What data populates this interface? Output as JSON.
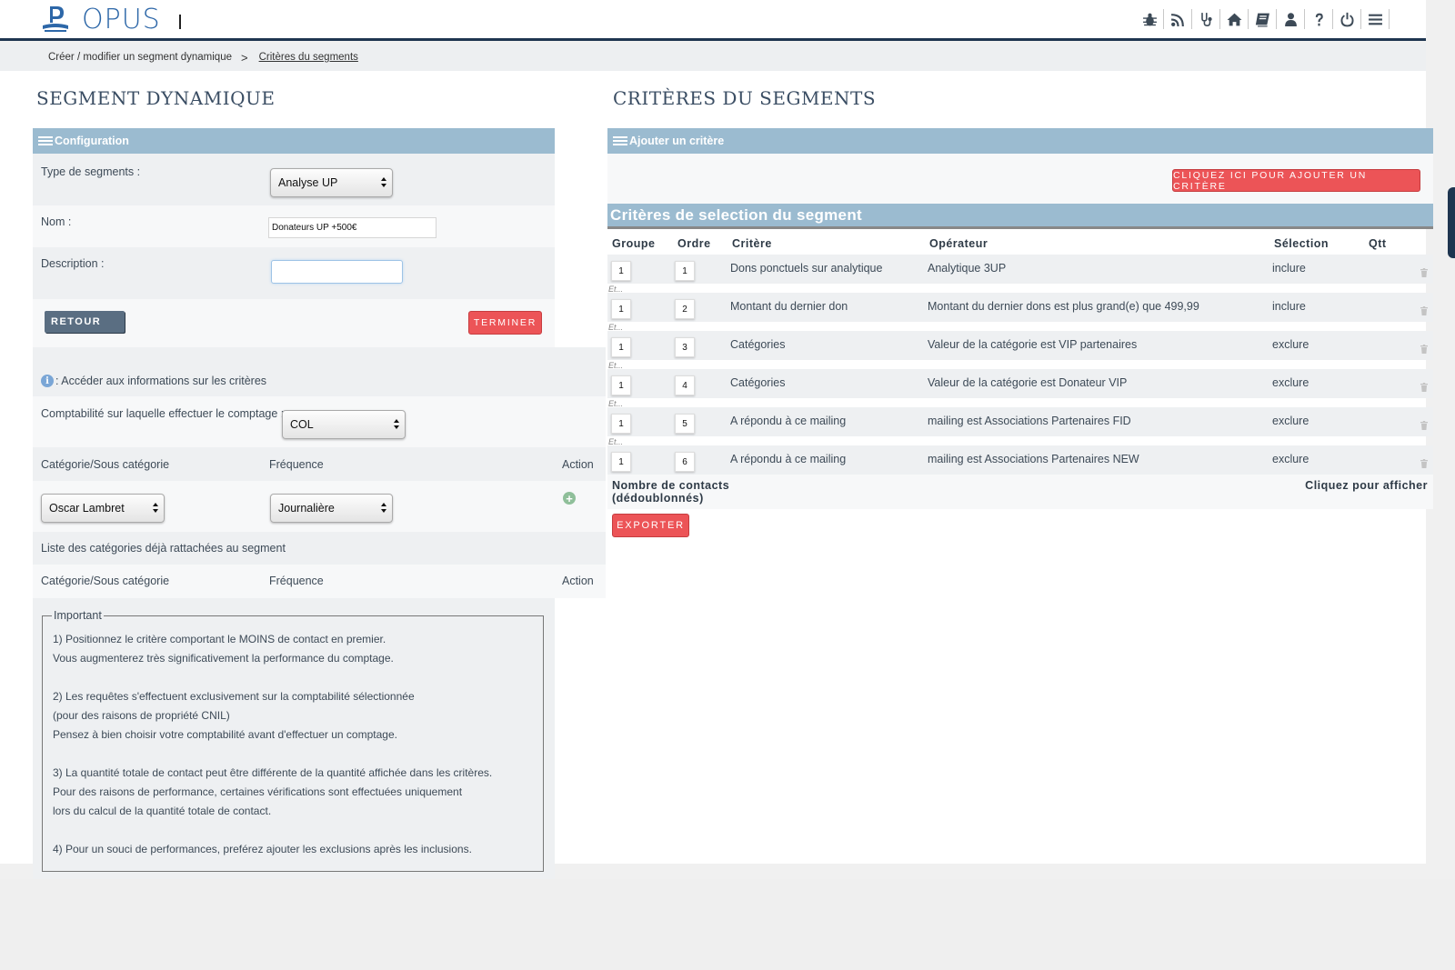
{
  "app": {
    "logo_text": "OPUS"
  },
  "header": {
    "icons": [
      "bug-icon",
      "rss-icon",
      "stethoscope-icon",
      "home-icon",
      "book-icon",
      "user-icon",
      "help-icon",
      "power-icon",
      "menu-icon"
    ]
  },
  "breadcrumb": {
    "items": [
      "Créer / modifier un segment dynamique",
      "Critères du segments"
    ],
    "separator": ">"
  },
  "left": {
    "title": "SEGMENT DYNAMIQUE",
    "config_label": "Configuration",
    "type_label": "Type de segments :",
    "type_value": "Analyse UP",
    "name_label": "Nom :",
    "name_value": "Donateurs UP +500€",
    "description_label": "Description :",
    "back_label": "RETOUR",
    "finish_label": "TERMINER",
    "info_text": ": Accéder aux informations sur les critères",
    "accounting_label": "Comptabilité sur laquelle effectuer le comptage :",
    "accounting_value": "COL",
    "cat_col_label": "Catégorie/Sous catégorie",
    "freq_col_label": "Fréquence",
    "action_col_label": "Action",
    "category_value": "Oscar Lambret",
    "frequency_value": "Journalière",
    "attached_label": "Liste des catégories déjà rattachées au segment",
    "important": {
      "legend": "Important",
      "lines": [
        "1) Positionnez le critère comportant le MOINS de contact en premier.",
        "Vous augmenterez très significativement la performance du comptage.",
        "",
        "2) Les requêtes s'effectuent exclusivement sur la comptabilité sélectionnée",
        "(pour des raisons de propriété CNIL)",
        "Pensez à bien choisir votre comptabilité avant d'effectuer un comptage.",
        "",
        "3) La quantité totale de contact peut être différente de la quantité affichée dans les critères.",
        "Pour des raisons de performance, certaines vérifications sont effectuées uniquement",
        "lors du calcul de la quantité totale de contact.",
        "",
        "4) Pour un souci de performances, preférez ajouter les exclusions après les inclusions."
      ]
    }
  },
  "right": {
    "title": "CRITÈRES DU SEGMENTS",
    "add_label": "Ajouter un critère",
    "add_button": "CLIQUEZ ICI POUR AJOUTER UN CRITÈRE",
    "selection_title": "Critères de selection du segment",
    "columns": [
      "Groupe",
      "Ordre",
      "Critère",
      "Opérateur",
      "Sélection",
      "Qtt"
    ],
    "and_label": "Et...",
    "rows": [
      {
        "group": "1",
        "order": "1",
        "criterion": "Dons ponctuels sur analytique",
        "operator": "Analytique 3UP",
        "selection": "inclure"
      },
      {
        "group": "1",
        "order": "2",
        "criterion": "Montant du dernier don",
        "operator": "Montant du dernier dons est plus grand(e) que 499,99",
        "selection": "inclure"
      },
      {
        "group": "1",
        "order": "3",
        "criterion": "Catégories",
        "operator": "Valeur de la catégorie est VIP partenaires",
        "selection": "exclure"
      },
      {
        "group": "1",
        "order": "4",
        "criterion": "Catégories",
        "operator": "Valeur de la catégorie est Donateur VIP",
        "selection": "exclure"
      },
      {
        "group": "1",
        "order": "5",
        "criterion": "A répondu à ce mailing",
        "operator": "mailing est Associations Partenaires FID",
        "selection": "exclure"
      },
      {
        "group": "1",
        "order": "6",
        "criterion": "A répondu à ce mailing",
        "operator": "mailing est Associations Partenaires NEW",
        "selection": "exclure"
      }
    ],
    "contacts_label_1": "Nombre de contacts",
    "contacts_label_2": "(dédoublonnés)",
    "show_label": "Cliquez pour afficher",
    "export_label": "EXPORTER"
  },
  "colors": {
    "accent": "#9bbbd0",
    "danger": "#ec5457",
    "navy": "#1e3550",
    "logo": "#2d67a8"
  }
}
